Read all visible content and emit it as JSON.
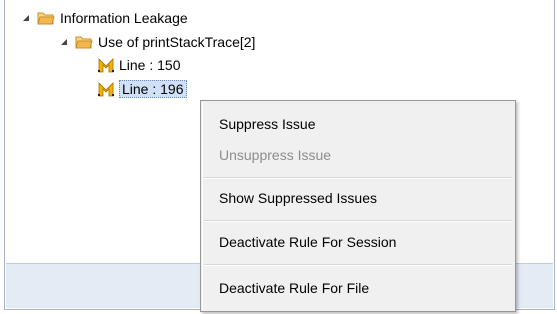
{
  "tree": {
    "category": {
      "label": "Information Leakage",
      "icon": "folder-icon",
      "expanded": true
    },
    "issue": {
      "label": "Use of printStackTrace[2]",
      "icon": "folder-icon",
      "expanded": true
    },
    "lines": [
      {
        "label": "Line : 150",
        "icon": "issue-marker-icon",
        "selected": false
      },
      {
        "label": "Line : 196",
        "icon": "issue-marker-icon",
        "selected": true
      }
    ]
  },
  "context_menu": {
    "items": [
      {
        "label": "Suppress Issue",
        "enabled": true
      },
      {
        "label": "Unsuppress Issue",
        "enabled": false
      },
      {
        "label": "Show Suppressed Issues",
        "enabled": true
      },
      {
        "label": "Deactivate Rule For Session",
        "enabled": true
      },
      {
        "label": "Deactivate Rule For File",
        "enabled": true
      }
    ]
  },
  "colors": {
    "folder": "#f0b74a",
    "marker": "#e8a300",
    "selection": "#cfe0f7",
    "panel": "#e5ebf5"
  }
}
